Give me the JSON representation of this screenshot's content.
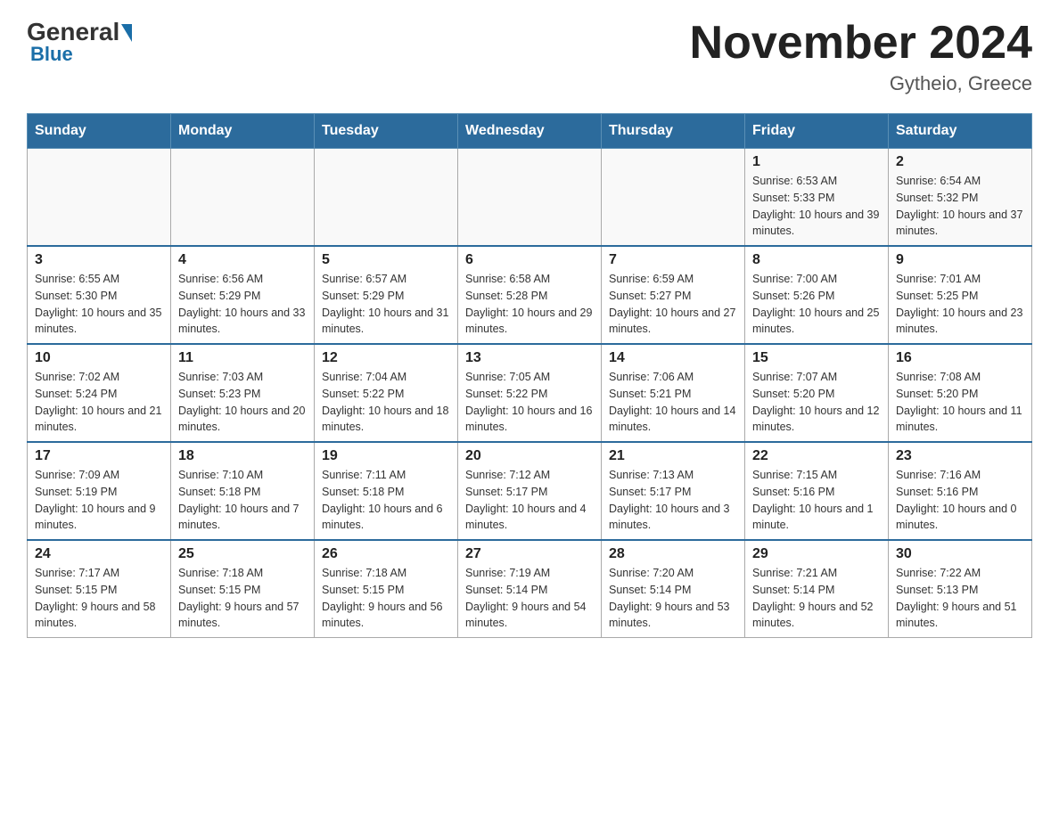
{
  "header": {
    "logo_text": "General",
    "logo_blue": "Blue",
    "month_title": "November 2024",
    "location": "Gytheio, Greece"
  },
  "calendar": {
    "days_of_week": [
      "Sunday",
      "Monday",
      "Tuesday",
      "Wednesday",
      "Thursday",
      "Friday",
      "Saturday"
    ],
    "weeks": [
      [
        {
          "day": "",
          "info": ""
        },
        {
          "day": "",
          "info": ""
        },
        {
          "day": "",
          "info": ""
        },
        {
          "day": "",
          "info": ""
        },
        {
          "day": "",
          "info": ""
        },
        {
          "day": "1",
          "info": "Sunrise: 6:53 AM\nSunset: 5:33 PM\nDaylight: 10 hours and 39 minutes."
        },
        {
          "day": "2",
          "info": "Sunrise: 6:54 AM\nSunset: 5:32 PM\nDaylight: 10 hours and 37 minutes."
        }
      ],
      [
        {
          "day": "3",
          "info": "Sunrise: 6:55 AM\nSunset: 5:30 PM\nDaylight: 10 hours and 35 minutes."
        },
        {
          "day": "4",
          "info": "Sunrise: 6:56 AM\nSunset: 5:29 PM\nDaylight: 10 hours and 33 minutes."
        },
        {
          "day": "5",
          "info": "Sunrise: 6:57 AM\nSunset: 5:29 PM\nDaylight: 10 hours and 31 minutes."
        },
        {
          "day": "6",
          "info": "Sunrise: 6:58 AM\nSunset: 5:28 PM\nDaylight: 10 hours and 29 minutes."
        },
        {
          "day": "7",
          "info": "Sunrise: 6:59 AM\nSunset: 5:27 PM\nDaylight: 10 hours and 27 minutes."
        },
        {
          "day": "8",
          "info": "Sunrise: 7:00 AM\nSunset: 5:26 PM\nDaylight: 10 hours and 25 minutes."
        },
        {
          "day": "9",
          "info": "Sunrise: 7:01 AM\nSunset: 5:25 PM\nDaylight: 10 hours and 23 minutes."
        }
      ],
      [
        {
          "day": "10",
          "info": "Sunrise: 7:02 AM\nSunset: 5:24 PM\nDaylight: 10 hours and 21 minutes."
        },
        {
          "day": "11",
          "info": "Sunrise: 7:03 AM\nSunset: 5:23 PM\nDaylight: 10 hours and 20 minutes."
        },
        {
          "day": "12",
          "info": "Sunrise: 7:04 AM\nSunset: 5:22 PM\nDaylight: 10 hours and 18 minutes."
        },
        {
          "day": "13",
          "info": "Sunrise: 7:05 AM\nSunset: 5:22 PM\nDaylight: 10 hours and 16 minutes."
        },
        {
          "day": "14",
          "info": "Sunrise: 7:06 AM\nSunset: 5:21 PM\nDaylight: 10 hours and 14 minutes."
        },
        {
          "day": "15",
          "info": "Sunrise: 7:07 AM\nSunset: 5:20 PM\nDaylight: 10 hours and 12 minutes."
        },
        {
          "day": "16",
          "info": "Sunrise: 7:08 AM\nSunset: 5:20 PM\nDaylight: 10 hours and 11 minutes."
        }
      ],
      [
        {
          "day": "17",
          "info": "Sunrise: 7:09 AM\nSunset: 5:19 PM\nDaylight: 10 hours and 9 minutes."
        },
        {
          "day": "18",
          "info": "Sunrise: 7:10 AM\nSunset: 5:18 PM\nDaylight: 10 hours and 7 minutes."
        },
        {
          "day": "19",
          "info": "Sunrise: 7:11 AM\nSunset: 5:18 PM\nDaylight: 10 hours and 6 minutes."
        },
        {
          "day": "20",
          "info": "Sunrise: 7:12 AM\nSunset: 5:17 PM\nDaylight: 10 hours and 4 minutes."
        },
        {
          "day": "21",
          "info": "Sunrise: 7:13 AM\nSunset: 5:17 PM\nDaylight: 10 hours and 3 minutes."
        },
        {
          "day": "22",
          "info": "Sunrise: 7:15 AM\nSunset: 5:16 PM\nDaylight: 10 hours and 1 minute."
        },
        {
          "day": "23",
          "info": "Sunrise: 7:16 AM\nSunset: 5:16 PM\nDaylight: 10 hours and 0 minutes."
        }
      ],
      [
        {
          "day": "24",
          "info": "Sunrise: 7:17 AM\nSunset: 5:15 PM\nDaylight: 9 hours and 58 minutes."
        },
        {
          "day": "25",
          "info": "Sunrise: 7:18 AM\nSunset: 5:15 PM\nDaylight: 9 hours and 57 minutes."
        },
        {
          "day": "26",
          "info": "Sunrise: 7:18 AM\nSunset: 5:15 PM\nDaylight: 9 hours and 56 minutes."
        },
        {
          "day": "27",
          "info": "Sunrise: 7:19 AM\nSunset: 5:14 PM\nDaylight: 9 hours and 54 minutes."
        },
        {
          "day": "28",
          "info": "Sunrise: 7:20 AM\nSunset: 5:14 PM\nDaylight: 9 hours and 53 minutes."
        },
        {
          "day": "29",
          "info": "Sunrise: 7:21 AM\nSunset: 5:14 PM\nDaylight: 9 hours and 52 minutes."
        },
        {
          "day": "30",
          "info": "Sunrise: 7:22 AM\nSunset: 5:13 PM\nDaylight: 9 hours and 51 minutes."
        }
      ]
    ]
  }
}
